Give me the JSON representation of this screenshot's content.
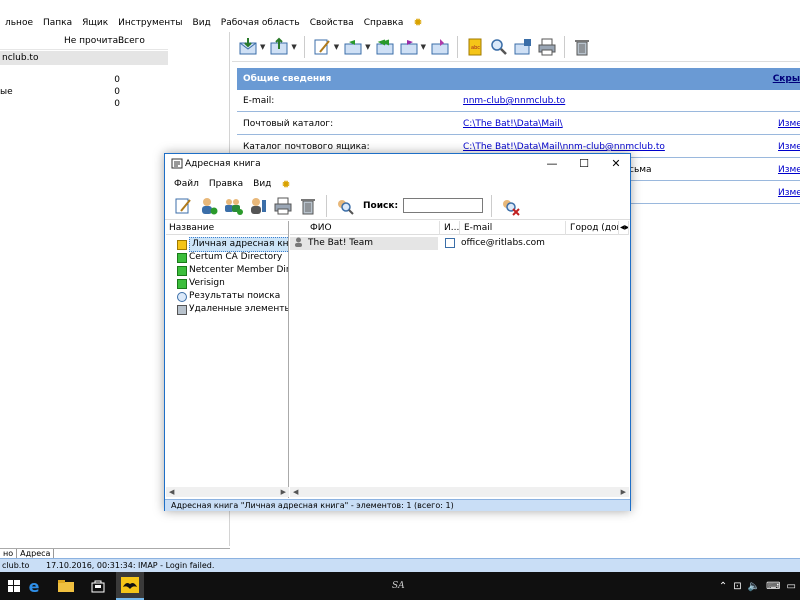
{
  "main": {
    "menu": [
      "льное",
      "Папка",
      "Ящик",
      "Инструменты",
      "Вид",
      "Рабочая область",
      "Свойства",
      "Справка"
    ],
    "left": {
      "col_unread": "Не прочита...",
      "col_total": "Всего",
      "account": "nclub.to",
      "rows": [
        {
          "label": "",
          "count": "0"
        },
        {
          "label": "ые",
          "count": "0"
        },
        {
          "label": "",
          "count": "0"
        }
      ],
      "bottom_tabs": [
        "но",
        "Адреса"
      ]
    },
    "info": {
      "header": "Общие сведения",
      "hide_link": "Скры",
      "rows": [
        {
          "label": "E-mail:",
          "value": "nnm-club@nnmclub.to",
          "change": ""
        },
        {
          "label": "Почтовый каталог:",
          "value": "C:\\The Bat!\\Data\\Mail\\",
          "change": "Измен"
        },
        {
          "label": "Каталог почтового ящика:",
          "value": "C:\\The Bat!\\Data\\Mail\\nnm-club@nnmclub.to",
          "change": "Измен"
        },
        {
          "label": "",
          "value": "",
          "partial": "сьма",
          "change": "Измен"
        },
        {
          "label": "",
          "value": "",
          "change": "Измен"
        }
      ]
    },
    "status": {
      "account": "club.to",
      "message": "17.10.2016, 00:31:34: IMAP  - Login failed."
    }
  },
  "address_book": {
    "title": "Адресная книга",
    "menu": [
      "Файл",
      "Правка",
      "Вид"
    ],
    "search_label": "Поиск:",
    "search_value": "",
    "tree_header": "Название",
    "tree": [
      {
        "label": "Личная адресная книга",
        "icon": "book-icon",
        "selected": true
      },
      {
        "label": "Certum CA Directory",
        "icon": "directory-icon"
      },
      {
        "label": "Netcenter Member Director",
        "icon": "directory-icon"
      },
      {
        "label": "Verisign",
        "icon": "directory-icon"
      },
      {
        "label": "Результаты поиска",
        "icon": "search-results-icon"
      },
      {
        "label": "Удаленные элементы",
        "icon": "trash-icon"
      }
    ],
    "columns": [
      "ФИО",
      "И...",
      "E-mail",
      "Город (дом..."
    ],
    "contacts": [
      {
        "name": "The Bat! Team",
        "email": "office@ritlabs.com"
      }
    ],
    "status": "Адресная книга \"Личная адресная книга\" - элементов: 1 (всего: 1)"
  },
  "taskbar": {
    "center_text": "SA"
  },
  "colors": {
    "info_header_bg": "#6a9ad4",
    "status_bg": "#c9def6",
    "link": "#0000cc",
    "taskbar_bg": "#101010",
    "dialog_border": "#1e6fc7"
  }
}
